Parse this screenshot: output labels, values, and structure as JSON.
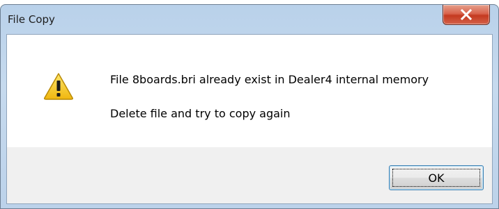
{
  "window": {
    "title": "File Copy",
    "close_glyph": "X"
  },
  "message": {
    "icon": "warning-icon",
    "line1": "File 8boards.bri already exist in Dealer4 internal memory",
    "line2": "Delete file and try to copy again"
  },
  "buttons": {
    "ok_label": "OK"
  },
  "colors": {
    "titlebar": "#c6daee",
    "close_button": "#c4391f",
    "warning_yellow": "#f5cc1e",
    "button_border": "#3c7fb1"
  }
}
